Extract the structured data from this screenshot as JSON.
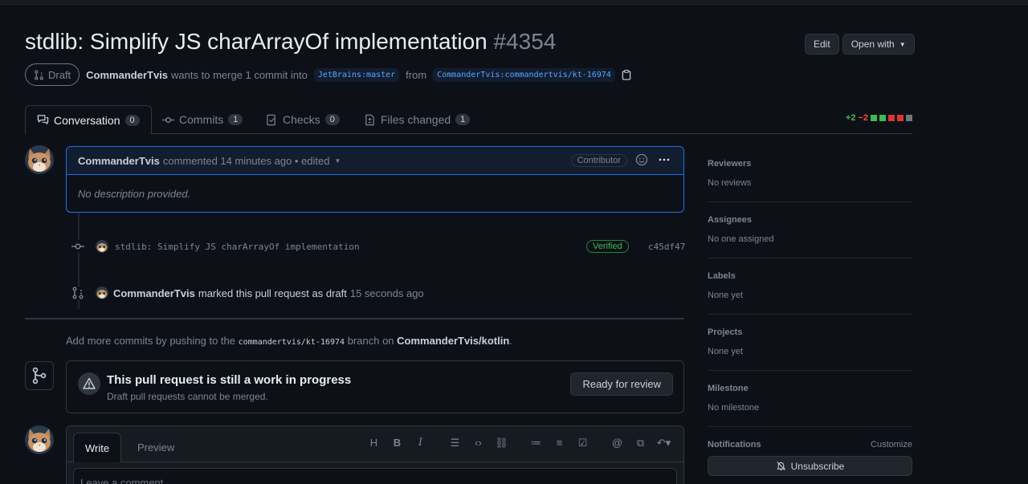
{
  "header": {
    "title": "stdlib: Simplify JS charArrayOf implementation",
    "number": "#4354",
    "edit_label": "Edit",
    "open_with_label": "Open with"
  },
  "meta": {
    "state": "Draft",
    "author": "CommanderTvis",
    "merge_text": "wants to merge 1 commit into",
    "base_branch": "JetBrains:master",
    "from_text": "from",
    "head_branch": "CommanderTvis:commandertvis/kt-16974"
  },
  "tabs": [
    {
      "label": "Conversation",
      "count": "0"
    },
    {
      "label": "Commits",
      "count": "1"
    },
    {
      "label": "Checks",
      "count": "0"
    },
    {
      "label": "Files changed",
      "count": "1"
    }
  ],
  "diffstat": {
    "additions": "+2",
    "deletions": "−2",
    "colors": [
      "#3fb950",
      "#3fb950",
      "#da3633",
      "#da3633",
      "#6e7681"
    ]
  },
  "comment": {
    "author": "CommanderTvis",
    "action": "commented 14 minutes ago • edited",
    "role": "Contributor",
    "body": "No description provided."
  },
  "commit_event": {
    "message": "stdlib: Simplify JS charArrayOf implementation",
    "verified": "Verified",
    "sha": "c45df47"
  },
  "draft_event": {
    "actor": "CommanderTvis",
    "text": "marked this pull request as draft",
    "time": "15 seconds ago"
  },
  "add_more": {
    "prefix": "Add more commits by pushing to the",
    "branch": "commandertvis/kt-16974",
    "middle": "branch on",
    "repo": "CommanderTvis/kotlin",
    "suffix": "."
  },
  "wip": {
    "title": "This pull request is still a work in progress",
    "subtitle": "Draft pull requests cannot be merged.",
    "button": "Ready for review"
  },
  "editor": {
    "write_tab": "Write",
    "preview_tab": "Preview",
    "placeholder": "Leave a comment"
  },
  "sidebar": {
    "reviewers": {
      "title": "Reviewers",
      "value": "No reviews"
    },
    "assignees": {
      "title": "Assignees",
      "value": "No one assigned"
    },
    "labels": {
      "title": "Labels",
      "value": "None yet"
    },
    "projects": {
      "title": "Projects",
      "value": "None yet"
    },
    "milestone": {
      "title": "Milestone",
      "value": "No milestone"
    },
    "notifications": {
      "title": "Notifications",
      "customize": "Customize",
      "unsubscribe": "Unsubscribe"
    }
  }
}
